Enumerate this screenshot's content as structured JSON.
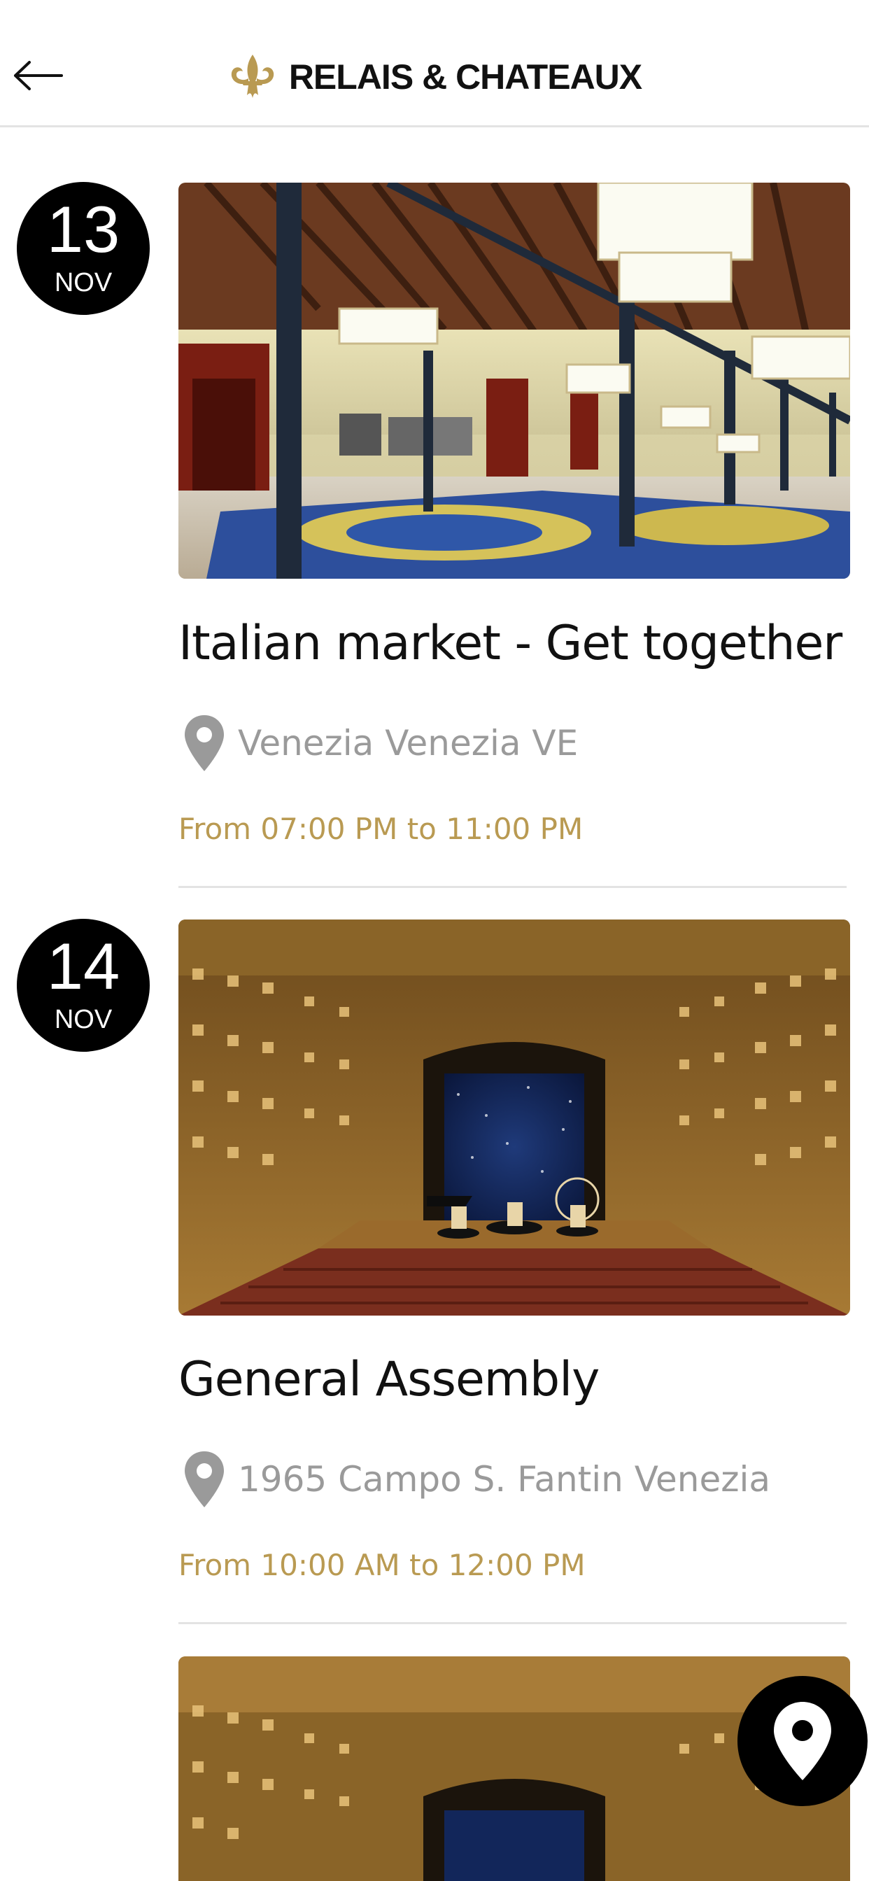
{
  "header": {
    "brand_name": "RELAIS & CHATEAUX",
    "logo_icon": "fleur-de-lis-icon",
    "back_icon": "arrow-left-icon"
  },
  "events": [
    {
      "day": "13",
      "month": "NOV",
      "title": "Italian market - Get together",
      "location": "Venezia Venezia VE",
      "time": "From 07:00 PM to 11:00 PM",
      "image": "ballroom-photo"
    },
    {
      "day": "14",
      "month": "NOV",
      "title": "General Assembly",
      "location": "1965 Campo S. Fantin Venezia",
      "time": "From 10:00 AM to 12:00 PM",
      "image": "theater-photo"
    },
    {
      "image": "theater-photo"
    }
  ],
  "map_button": {
    "icon": "map-pin-icon"
  },
  "colors": {
    "accent_gold": "#b99a52",
    "location_gray": "#9a9a9a",
    "badge_black": "#000000"
  }
}
